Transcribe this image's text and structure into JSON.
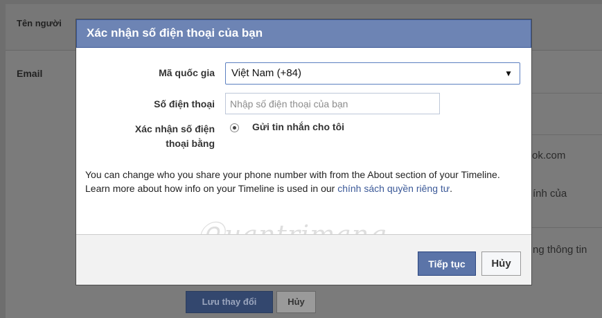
{
  "background": {
    "name_label_partial": "Tên người",
    "email_label": "Email",
    "right_texts": [
      "ok.com",
      "ính của",
      "ng thông tin"
    ],
    "save_button": "Lưu thay đổi",
    "cancel_button": "Hủy"
  },
  "dialog": {
    "title": "Xác nhận số điện thoại của bạn",
    "country_label": "Mã quốc gia",
    "country_value": "Việt Nam (+84)",
    "phone_label": "Số điện thoại",
    "phone_placeholder": "Nhập số điện thoại của bạn",
    "phone_value": "",
    "confirm_label_line1": "Xác nhận số điện",
    "confirm_label_line2": "thoại bằng",
    "radio_option": "Gửi tin nhắn cho tôi",
    "info_text": "You can change who you share your phone number with from the About section of your Timeline. Learn more about how info on your Timeline is used in our ",
    "info_link": "chính sách quyền riêng tư",
    "info_end": ".",
    "continue_button": "Tiếp tục",
    "cancel_button": "Hủy"
  },
  "watermark": "uantrimang",
  "colors": {
    "header": "#6d84b4",
    "primary_button": "#5b74a8",
    "link": "#3b5998"
  },
  "icons": {
    "dropdown": "caret-down-icon",
    "radio": "radio-selected-icon"
  }
}
